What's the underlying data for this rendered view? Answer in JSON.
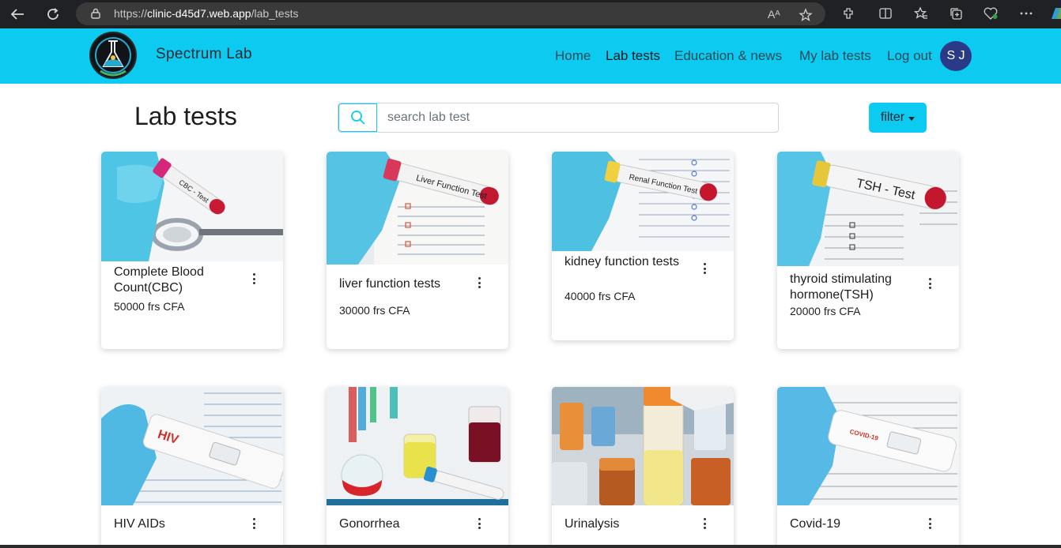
{
  "browser": {
    "url_prefix": "https://",
    "url_host": "clinic-d45d7.web.app",
    "url_path": "/lab_tests",
    "read_aloud": "Aᴬ"
  },
  "navbar": {
    "brand": "Spectrum Lab",
    "links": [
      "Home",
      "Lab tests",
      "Education & news",
      "My lab tests",
      "Log out"
    ],
    "active_link": "Lab tests",
    "avatar_initials": "S J",
    "color": "#0dcaf0"
  },
  "main": {
    "title": "Lab tests",
    "search_placeholder": "search lab test",
    "filter_label": "filter"
  },
  "tests": [
    {
      "name": "Complete Blood Count(CBC)",
      "price": "50000 frs CFA",
      "label": "CBC - Test"
    },
    {
      "name": "liver function tests",
      "price": "30000 frs CFA",
      "label": "Liver Function Test"
    },
    {
      "name": "kidney function tests",
      "price": "40000 frs CFA",
      "label": "Renal Function Test"
    },
    {
      "name": "thyroid stimulating hormone(TSH)",
      "price": "20000 frs CFA",
      "label": "TSH - Test"
    },
    {
      "name": "HIV AIDs",
      "price": "",
      "label": "HIV"
    },
    {
      "name": "Gonorrhea",
      "price": "",
      "label": ""
    },
    {
      "name": "Urinalysis",
      "price": "",
      "label": ""
    },
    {
      "name": "Covid-19",
      "price": "",
      "label": "COVID-19"
    }
  ]
}
